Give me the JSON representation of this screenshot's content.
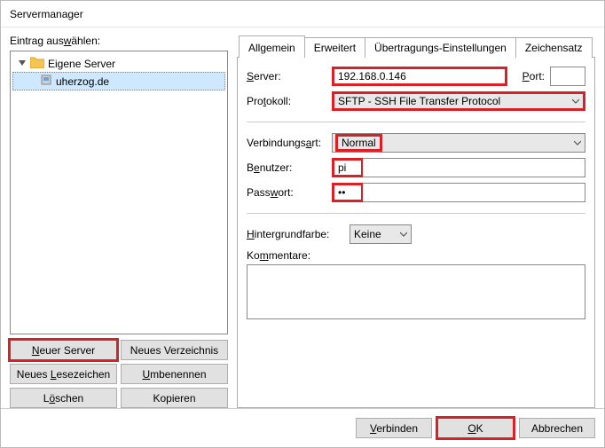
{
  "window": {
    "title": "Servermanager"
  },
  "left": {
    "label": "Eintrag auswählen:",
    "root": "Eigene Server",
    "entries": [
      {
        "label": "uherzog.de",
        "selected": true
      }
    ],
    "buttons": {
      "new_server": "Neuer Server",
      "new_folder": "Neues Verzeichnis",
      "new_bookmark": "Neues Lesezeichen",
      "rename": "Umbenennen",
      "delete": "Löschen",
      "copy": "Kopieren"
    }
  },
  "tabs": {
    "general": "Allgemein",
    "advanced": "Erweitert",
    "transfer": "Übertragungs-Einstellungen",
    "charset": "Zeichensatz"
  },
  "form": {
    "server_label": "Server:",
    "server_value": "192.168.0.146",
    "port_label": "Port:",
    "port_value": "",
    "protocol_label": "Protokoll:",
    "protocol_value": "SFTP - SSH File Transfer Protocol",
    "conn_type_label": "Verbindungsart:",
    "conn_type_value": "Normal",
    "user_label": "Benutzer:",
    "user_value": "pi",
    "password_label": "Passwort:",
    "password_value": "••",
    "bgcolor_label": "Hintergrundfarbe:",
    "bgcolor_value": "Keine",
    "comments_label": "Kommentare:",
    "comments_value": ""
  },
  "footer": {
    "connect": "Verbinden",
    "ok": "OK",
    "cancel": "Abbrechen"
  }
}
